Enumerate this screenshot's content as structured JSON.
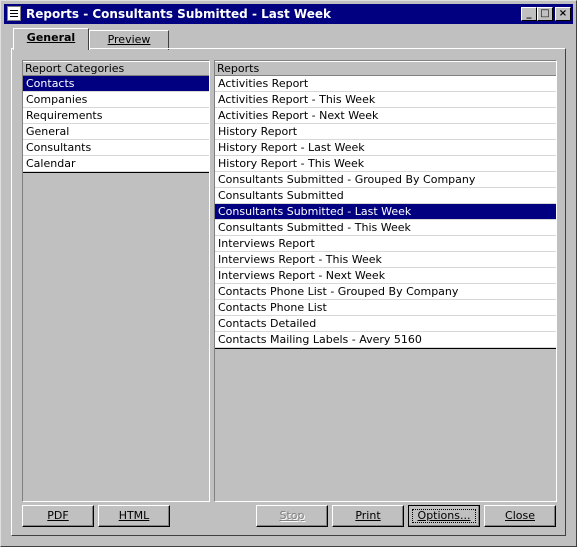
{
  "window": {
    "title": "Reports - Consultants Submitted - Last Week"
  },
  "title_buttons": {
    "minimize": "_",
    "maximize": "□",
    "close": "×"
  },
  "tabs": [
    {
      "label": "General"
    },
    {
      "label": "Preview"
    }
  ],
  "categories": {
    "header": "Report Categories",
    "items": [
      "Contacts",
      "Companies",
      "Requirements",
      "General",
      "Consultants",
      "Calendar"
    ],
    "selected": "Contacts"
  },
  "reports": {
    "header": "Reports",
    "items": [
      "Activities Report",
      "Activities Report - This Week",
      "Activities Report - Next Week",
      "History Report",
      "History Report - Last Week",
      "History Report - This Week",
      "Consultants Submitted - Grouped By Company",
      "Consultants Submitted",
      "Consultants Submitted - Last Week",
      "Consultants Submitted - This Week",
      "Interviews Report",
      "Interviews Report - This Week",
      "Interviews Report - Next Week",
      "Contacts Phone List - Grouped By Company",
      "Contacts Phone List",
      "Contacts Detailed",
      "Contacts Mailing Labels - Avery 5160"
    ],
    "selected": "Consultants Submitted - Last Week"
  },
  "buttons": {
    "pdf": "PDF",
    "html": "HTML",
    "stop": "Stop",
    "print": "Print",
    "options": "Options...",
    "close": "Close"
  }
}
